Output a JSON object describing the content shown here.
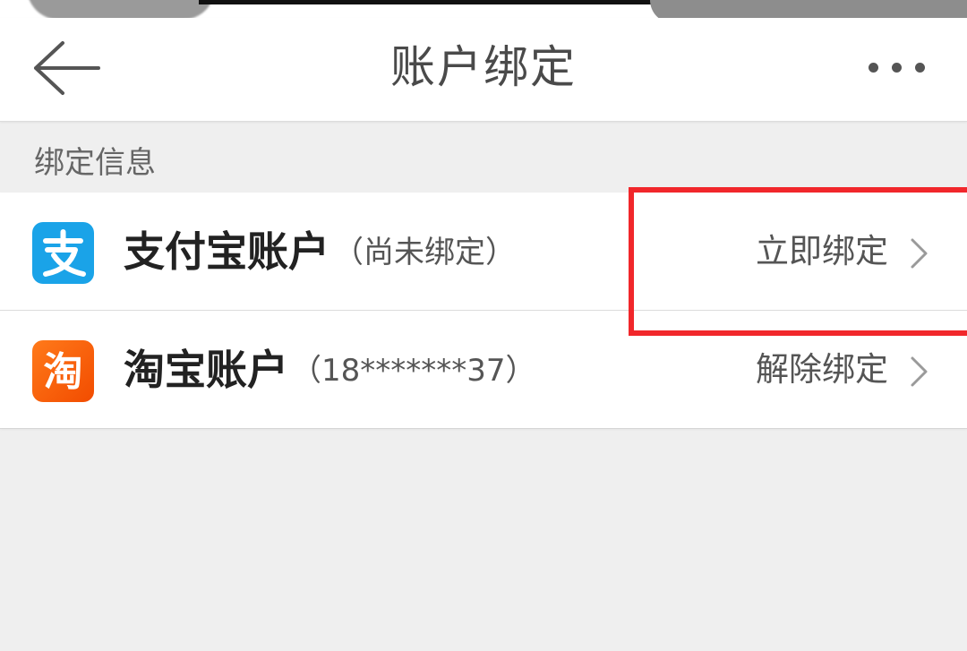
{
  "header": {
    "title": "账户绑定"
  },
  "section": {
    "label": "绑定信息"
  },
  "accounts": [
    {
      "icon": "alipay-icon",
      "name": "支付宝账户",
      "status": "（尚未绑定）",
      "action": "立即绑定"
    },
    {
      "icon": "taobao-icon",
      "name": "淘宝账户",
      "status": "（18*******37）",
      "action": "解除绑定"
    }
  ],
  "colors": {
    "alipay": "#1aa3e8",
    "taobao": "#ff6a00",
    "highlight": "#f1272b"
  }
}
